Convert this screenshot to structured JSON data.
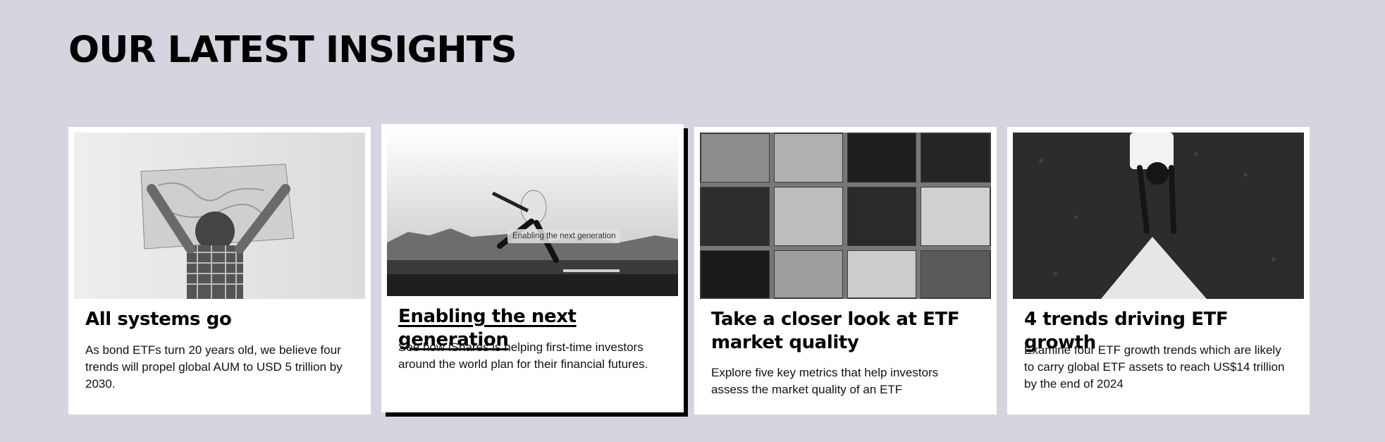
{
  "section": {
    "title": "OUR LATEST INSIGHTS"
  },
  "cards": [
    {
      "title": "All systems go",
      "description": "As bond ETFs turn 20 years old, we believe four trends will propel global AUM to USD 5 trillion by 2030.",
      "image": "person-holding-world-map"
    },
    {
      "title": "Enabling the next generation",
      "description": "See how iShares is helping first-time investors around the world plan for their financial futures.",
      "image": "person-jumping-landscape",
      "tooltip": "Enabling the next generation"
    },
    {
      "title": "Take a closer look at ETF market quality",
      "description": "Explore five key metrics that help investors assess the market quality of an ETF",
      "image": "spice-tray-grid"
    },
    {
      "title": "4 trends driving ETF growth",
      "description": "Examine four ETF growth trends which are likely to carry global ETF assets to reach US$14 trillion by the end of 2024",
      "image": "child-painting-arrow-on-road"
    }
  ],
  "colors": {
    "background": "#d6d4df",
    "card": "#ffffff",
    "text": "#000000"
  }
}
